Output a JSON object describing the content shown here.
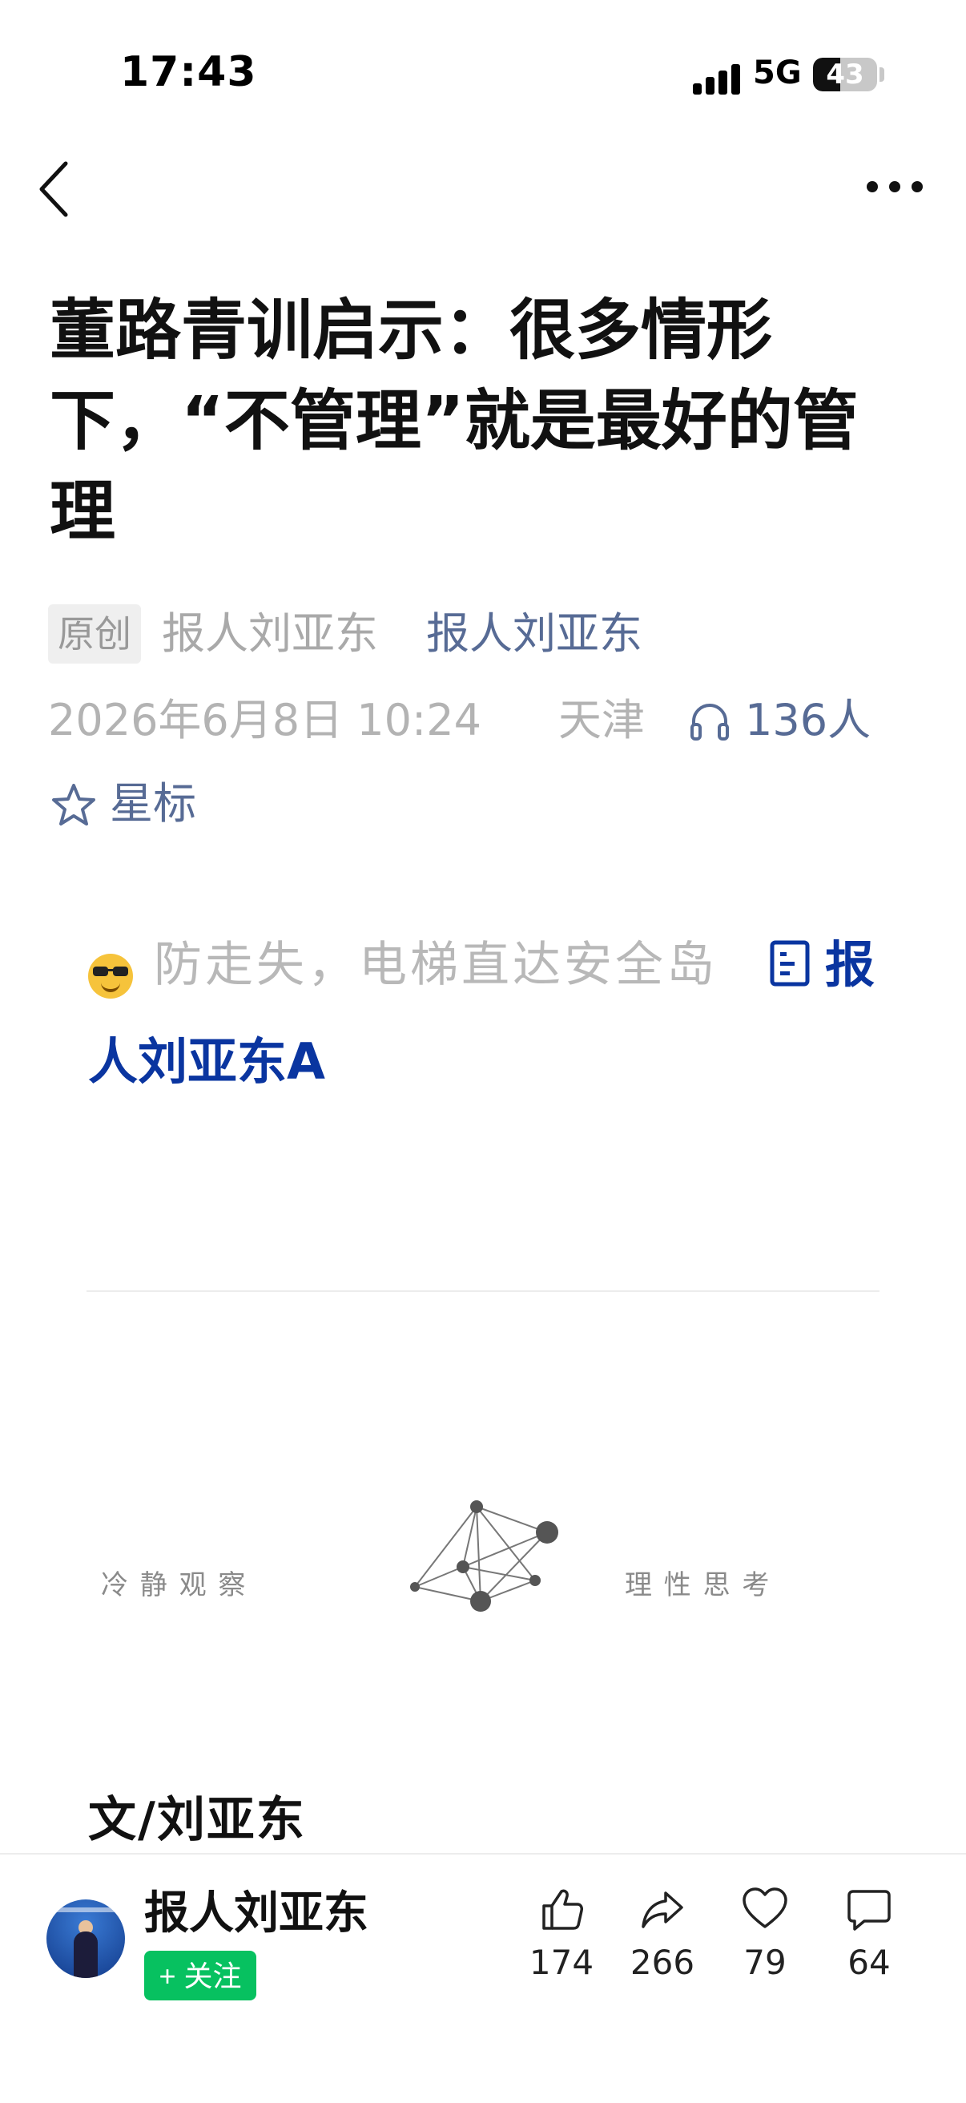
{
  "status_bar": {
    "time": "17:43",
    "network": "5G",
    "battery": "43",
    "battery_level": 0.43
  },
  "article": {
    "title": "董路青训启示：很多情形下，“不管理”就是最好的管理",
    "badge": "原创",
    "author_plain": "报人刘亚东",
    "author_link": "报人刘亚东",
    "date": "2026年6月8日 10:24",
    "location": "天津",
    "listen_count": "136人",
    "star_label": "星标",
    "notice_text": "防走失，电梯直达安全岛",
    "notice_link_part1": "报",
    "notice_link_part2": "人刘亚东A",
    "banner_left": "冷 静 观 察",
    "banner_right": "理 性 思 考",
    "byline": "文/刘亚东"
  },
  "bottom_bar": {
    "author_name": "报人刘亚东",
    "follow_label": "+ 关注",
    "likes": "174",
    "shares": "266",
    "favorites": "79",
    "comments": "64"
  },
  "colors": {
    "link": "#576b95",
    "notice_link": "#0a35a0",
    "follow_green": "#07c160"
  }
}
